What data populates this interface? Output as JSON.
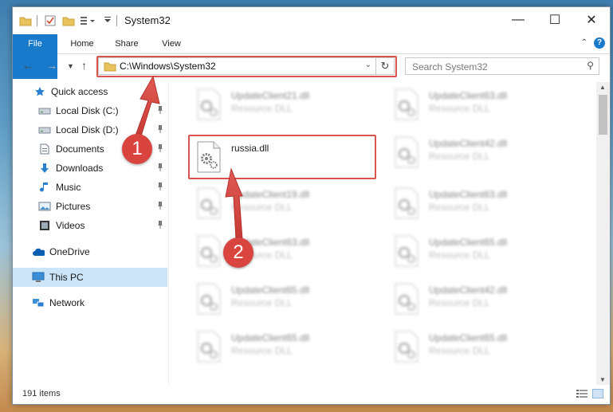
{
  "window": {
    "title": "System32",
    "controls": {
      "minimize": "—",
      "maximize": "☐",
      "close": "✕"
    }
  },
  "ribbon": {
    "tabs": [
      "File",
      "Home",
      "Share",
      "View"
    ],
    "help": "?"
  },
  "address_bar": {
    "path": "C:\\Windows\\System32",
    "search_placeholder": "Search System32"
  },
  "nav_pane": {
    "quick_access": "Quick access",
    "items": [
      {
        "label": "Local Disk (C:)",
        "icon": "drive-icon",
        "pinned": true
      },
      {
        "label": "Local Disk (D:)",
        "icon": "drive-icon",
        "pinned": true
      },
      {
        "label": "Documents",
        "icon": "documents-icon",
        "pinned": true
      },
      {
        "label": "Downloads",
        "icon": "downloads-icon",
        "pinned": true
      },
      {
        "label": "Music",
        "icon": "music-icon",
        "pinned": true
      },
      {
        "label": "Pictures",
        "icon": "pictures-icon",
        "pinned": true
      },
      {
        "label": "Videos",
        "icon": "videos-icon",
        "pinned": true
      }
    ],
    "onedrive": "OneDrive",
    "this_pc": "This PC",
    "network": "Network"
  },
  "files": {
    "highlighted": {
      "name": "russia.dll"
    },
    "left_column": [
      {
        "name": "UpdateClient21.dll",
        "type": "Resource DLL"
      },
      {
        "name": "UpdateClient19.dll",
        "type": "Resource DLL"
      },
      {
        "name": "UpdateClient63.dll",
        "type": "Resource DLL"
      },
      {
        "name": "UpdateClient65.dll",
        "type": "Resource DLL"
      },
      {
        "name": "UpdateClient65.dll",
        "type": "Resource DLL"
      }
    ],
    "right_column": [
      {
        "name": "UpdateClient63.dll",
        "type": "Resource DLL"
      },
      {
        "name": "UpdateClient42.dll",
        "type": "Resource DLL"
      },
      {
        "name": "UpdateClient63.dll",
        "type": "Resource DLL"
      },
      {
        "name": "UpdateClient65.dll",
        "type": "Resource DLL"
      },
      {
        "name": "UpdateClient42.dll",
        "type": "Resource DLL"
      },
      {
        "name": "UpdateClient65.dll",
        "type": "Resource DLL"
      }
    ]
  },
  "status_bar": {
    "item_count": "191 items"
  },
  "annotations": {
    "step1": "1",
    "step2": "2",
    "color": "#d9443f"
  },
  "colors": {
    "accent": "#1979ca",
    "selection": "#cce4f7",
    "callout": "#d9534f"
  }
}
